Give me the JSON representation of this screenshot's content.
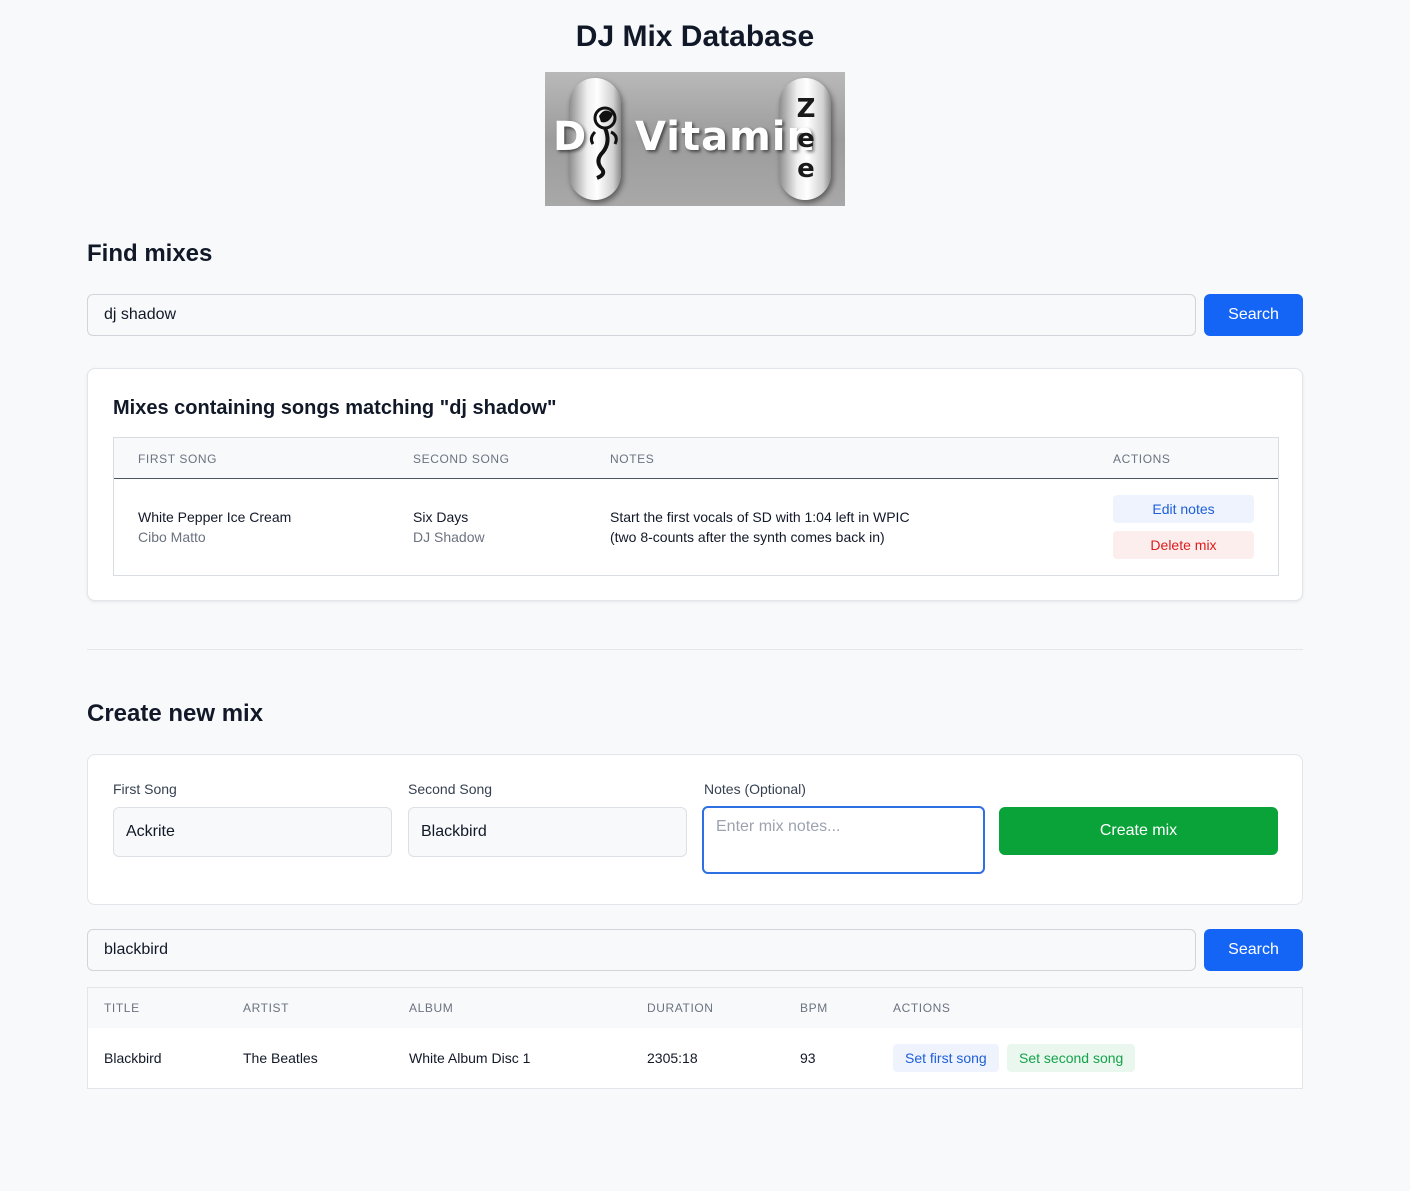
{
  "page": {
    "title": "DJ Mix Database"
  },
  "logo": {
    "text_d": "D",
    "text_main": "Vitamin",
    "text_zee": [
      "Z",
      "e",
      "e"
    ]
  },
  "find": {
    "heading": "Find mixes",
    "query": "dj shadow",
    "search_label": "Search",
    "results_title": "Mixes containing songs matching \"dj shadow\"",
    "columns": [
      "FIRST SONG",
      "SECOND SONG",
      "NOTES",
      "ACTIONS"
    ],
    "rows": [
      {
        "first_title": "White Pepper Ice Cream",
        "first_artist": "Cibo Matto",
        "second_title": "Six Days",
        "second_artist": "DJ Shadow",
        "notes_line1": "Start the first vocals of SD with 1:04 left in WPIC",
        "notes_line2": "(two 8-counts after the synth comes back in)",
        "edit_label": "Edit notes",
        "delete_label": "Delete mix"
      }
    ]
  },
  "create": {
    "heading": "Create new mix",
    "first_label": "First Song",
    "first_value": "Ackrite",
    "second_label": "Second Song",
    "second_value": "Blackbird",
    "notes_label": "Notes (Optional)",
    "notes_placeholder": "Enter mix notes...",
    "create_label": "Create mix"
  },
  "song_search": {
    "query": "blackbird",
    "search_label": "Search",
    "columns": [
      "TITLE",
      "ARTIST",
      "ALBUM",
      "DURATION",
      "BPM",
      "ACTIONS"
    ],
    "rows": [
      {
        "title": "Blackbird",
        "artist": "The Beatles",
        "album": "White Album Disc 1",
        "duration": "2305:18",
        "bpm": "93",
        "first_label": "Set first song",
        "second_label": "Set second song"
      }
    ]
  },
  "colors": {
    "primary": "#1465f5",
    "success": "#0aa33a",
    "danger": "#dc1c1c",
    "background": "#f8f9fb"
  }
}
